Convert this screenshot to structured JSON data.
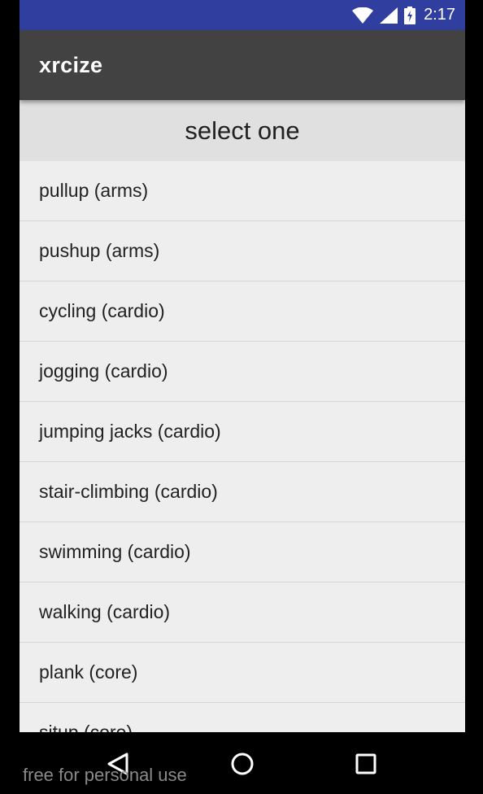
{
  "status_bar": {
    "time": "2:17",
    "icons": [
      "wifi-icon",
      "cell-signal-icon",
      "battery-charging-icon"
    ]
  },
  "app_bar": {
    "title": "xrcize"
  },
  "list": {
    "header": "select one",
    "items": [
      "pullup (arms)",
      "pushup (arms)",
      "cycling (cardio)",
      "jogging (cardio)",
      "jumping jacks (cardio)",
      "stair-climbing (cardio)",
      "swimming (cardio)",
      "walking (cardio)",
      "plank (core)",
      "situp (core)"
    ]
  },
  "nav_bar": {
    "icons": [
      "back-icon",
      "home-icon",
      "recents-icon"
    ]
  },
  "watermark": "free for personal use",
  "colors": {
    "status_bar": "#303f9f",
    "app_bar": "#424242",
    "list_header": "#e0e0e0",
    "list_bg": "#eeeeee",
    "nav_bar": "#000000"
  }
}
